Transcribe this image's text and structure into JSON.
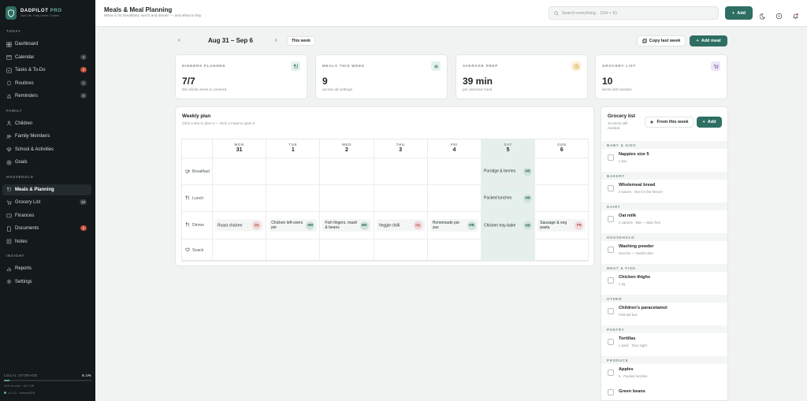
{
  "brand": {
    "name": "DADPILOT",
    "suffix": "PRO",
    "tagline": "Dad Life. Fully Under Control."
  },
  "sidebar": {
    "sections": [
      {
        "title": "TODAY",
        "items": [
          {
            "label": "Dashboard",
            "icon": "grid-icon",
            "badge": ""
          },
          {
            "label": "Calendar",
            "icon": "calendar-icon",
            "badge": "3"
          },
          {
            "label": "Tasks & To-Do",
            "icon": "checkbox-icon",
            "badge": "2",
            "badge_color": "#c44d3c"
          },
          {
            "label": "Routines",
            "icon": "repeat-icon",
            "badge": "1"
          },
          {
            "label": "Reminders",
            "icon": "bell-icon",
            "badge": "5"
          }
        ]
      },
      {
        "title": "FAMILY",
        "items": [
          {
            "label": "Children",
            "icon": "child-icon",
            "badge": ""
          },
          {
            "label": "Family Members",
            "icon": "users-icon",
            "badge": ""
          },
          {
            "label": "School & Activities",
            "icon": "school-icon",
            "badge": ""
          },
          {
            "label": "Goals",
            "icon": "target-icon",
            "badge": ""
          }
        ]
      },
      {
        "title": "HOUSEHOLD",
        "items": [
          {
            "label": "Meals & Planning",
            "icon": "utensils-icon",
            "badge": "",
            "active": true
          },
          {
            "label": "Grocery List",
            "icon": "cart-icon",
            "badge": "10"
          },
          {
            "label": "Finances",
            "icon": "wallet-icon",
            "badge": ""
          },
          {
            "label": "Documents",
            "icon": "document-icon",
            "badge": "2",
            "badge_color": "#c44d3c"
          },
          {
            "label": "Notes",
            "icon": "note-icon",
            "badge": ""
          }
        ]
      },
      {
        "title": "INSIGHT",
        "items": [
          {
            "label": "Reports",
            "icon": "chart-icon",
            "badge": ""
          },
          {
            "label": "Settings",
            "icon": "gear-icon",
            "badge": ""
          }
        ]
      }
    ]
  },
  "storage": {
    "label": "LOCAL STORAGE",
    "percent": "6.1%",
    "fill_fraction": 0.061,
    "records": "216 records · 64.7 kB",
    "version": "v1.0.0 · IndexedDB"
  },
  "header": {
    "title": "Meals & Meal Planning",
    "subtitle": "What is for breakfast, lunch and dinner — and what to buy",
    "search_placeholder": "Search everything... (Ctrl + K)",
    "add_label": "Add"
  },
  "week": {
    "range": "Aug 31 – Sep 6",
    "this_week": "This week",
    "copy_label": "Copy last week",
    "add_meal_label": "Add meal"
  },
  "stats": [
    {
      "label": "DINNERS PLANNED",
      "value": "7/7",
      "sub": "the whole week is covered",
      "icon": "utensils-icon",
      "icon_bg": "#e4f1ec",
      "icon_color": "#2f6f63"
    },
    {
      "label": "MEALS THIS WEEK",
      "value": "9",
      "sub": "across all settings",
      "icon": "list-icon",
      "icon_bg": "#e4f1ec",
      "icon_color": "#2f6f63"
    },
    {
      "label": "AVERAGE PREP",
      "value": "39 min",
      "sub": "per planned meal",
      "icon": "clock-icon",
      "icon_bg": "#fbf0d6",
      "icon_color": "#c79a2c"
    },
    {
      "label": "GROCERY LIST",
      "value": "10",
      "sub": "items still needed",
      "icon": "cart-icon",
      "icon_bg": "#ece6f6",
      "icon_color": "#7a5fb0"
    }
  ],
  "plan": {
    "title": "Weekly plan",
    "subtitle": "Click a slot to plan it — click a meal to open it",
    "days": [
      {
        "name": "MON",
        "date": "31"
      },
      {
        "name": "TUE",
        "date": "1"
      },
      {
        "name": "WED",
        "date": "2"
      },
      {
        "name": "THU",
        "date": "3"
      },
      {
        "name": "FRI",
        "date": "4"
      },
      {
        "name": "SAT",
        "date": "5",
        "today": true
      },
      {
        "name": "SUN",
        "date": "6"
      }
    ],
    "rows": [
      {
        "label": "Breakfast",
        "icon": "coffee-icon",
        "meals": [
          null,
          null,
          null,
          null,
          null,
          {
            "name": "Porridge & berries",
            "who": "MB"
          },
          null
        ]
      },
      {
        "label": "Lunch",
        "icon": "utensils-icon",
        "meals": [
          null,
          null,
          null,
          null,
          null,
          {
            "name": "Packed lunches",
            "who": "MB"
          },
          null
        ]
      },
      {
        "label": "Dinner",
        "icon": "utensils-icon",
        "meals": [
          {
            "name": "Roast chicken",
            "who": "PB"
          },
          {
            "name": "Chicken left-overs pie",
            "who": "MB"
          },
          {
            "name": "Fish fingers, mash & beans",
            "who": "MB"
          },
          {
            "name": "Veggie chilli",
            "who": "PB"
          },
          {
            "name": "Homemade piz-zas",
            "who": "MB"
          },
          {
            "name": "Chicken tray-bake",
            "who": "MB"
          },
          {
            "name": "Sausage & veg pasta",
            "who": "PB"
          }
        ]
      },
      {
        "label": "Snack",
        "icon": "heart-icon",
        "meals": [
          null,
          null,
          null,
          null,
          null,
          null,
          null
        ]
      }
    ]
  },
  "grocery": {
    "title": "Grocery list",
    "subtitle": "10 items still needed",
    "from_week_label": "From this week",
    "add_label": "Add",
    "categories": [
      {
        "name": "BABY & KIDS",
        "items": [
          {
            "name": "Nappies size 5",
            "note": "1 box"
          }
        ]
      },
      {
        "name": "BAKERY",
        "items": [
          {
            "name": "Wholemeal bread",
            "note": "3 loaves · One for the freezer"
          }
        ]
      },
      {
        "name": "DAIRY",
        "items": [
          {
            "name": "Oat milk",
            "note": "2 cartons · Mia — dairy free"
          }
        ]
      },
      {
        "name": "HOUSEHOLD",
        "items": [
          {
            "name": "Washing powder",
            "note": "Non-bio — Noah's skin"
          }
        ]
      },
      {
        "name": "MEAT & FISH",
        "items": [
          {
            "name": "Chicken thighs",
            "note": "1 kg"
          }
        ]
      },
      {
        "name": "OTHER",
        "items": [
          {
            "name": "Children's paracetamol",
            "note": "First-aid box"
          }
        ]
      },
      {
        "name": "PANTRY",
        "items": [
          {
            "name": "Tortillas",
            "note": "1 pack · Taco night"
          }
        ]
      },
      {
        "name": "PRODUCE",
        "items": [
          {
            "name": "Apples",
            "note": "6 · Packed lunches"
          },
          {
            "name": "Green beans",
            "note": ""
          }
        ]
      }
    ]
  }
}
